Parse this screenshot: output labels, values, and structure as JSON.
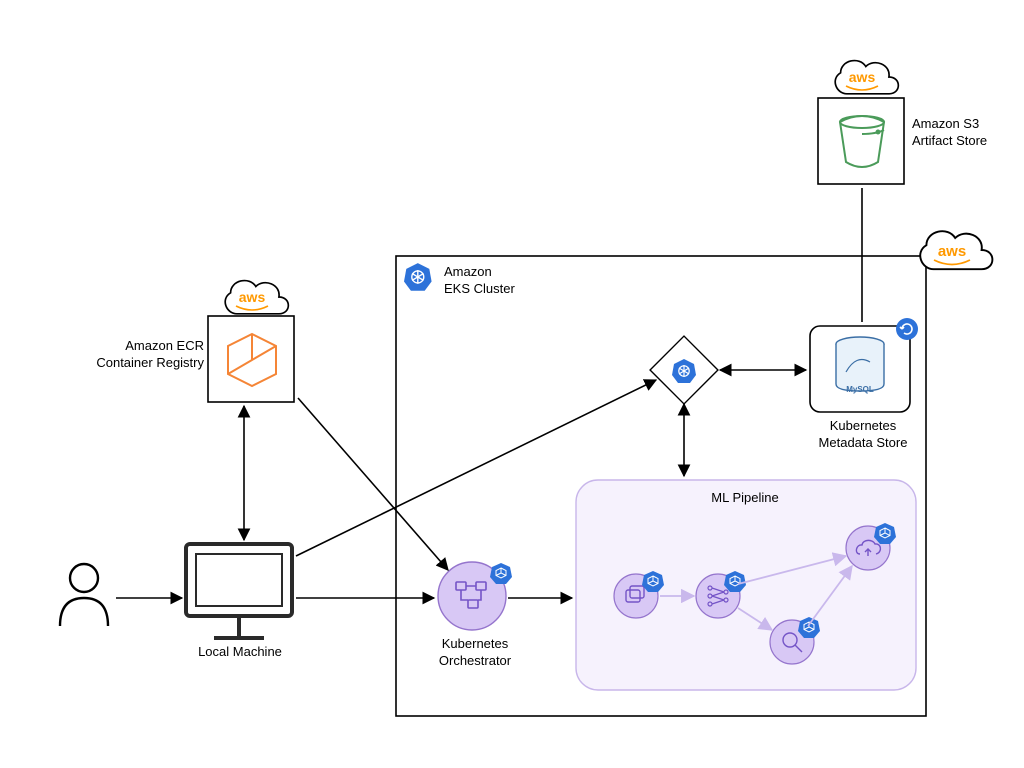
{
  "nodes": {
    "user": {
      "label": ""
    },
    "local_machine": {
      "label": "Local Machine"
    },
    "ecr": {
      "label": "Amazon ECR\nContainer Registry"
    },
    "eks_cluster": {
      "label": "Amazon\nEKS Cluster"
    },
    "orchestrator": {
      "label": "Kubernetes\nOrchestrator"
    },
    "k8s_diamond": {
      "label": ""
    },
    "metadata_store": {
      "label": "Kubernetes\nMetadata Store"
    },
    "ml_pipeline": {
      "label": "ML Pipeline"
    },
    "step_data": {
      "label": ""
    },
    "step_train": {
      "label": ""
    },
    "step_eval": {
      "label": ""
    },
    "step_deploy": {
      "label": ""
    },
    "s3": {
      "label": "Amazon S3\nArtifact Store"
    },
    "aws_top": {
      "label": "aws"
    },
    "aws_mid": {
      "label": "aws"
    },
    "aws_left": {
      "label": "aws"
    }
  },
  "edges": [
    {
      "from": "user",
      "to": "local_machine",
      "dir": "fwd"
    },
    {
      "from": "local_machine",
      "to": "ecr",
      "dir": "both"
    },
    {
      "from": "local_machine",
      "to": "orchestrator",
      "dir": "fwd"
    },
    {
      "from": "local_machine",
      "to": "k8s_diamond",
      "dir": "fwd"
    },
    {
      "from": "ecr",
      "to": "orchestrator",
      "dir": "fwd"
    },
    {
      "from": "orchestrator",
      "to": "ml_pipeline",
      "dir": "fwd"
    },
    {
      "from": "k8s_diamond",
      "to": "metadata_store",
      "dir": "both"
    },
    {
      "from": "k8s_diamond",
      "to": "ml_pipeline",
      "dir": "both"
    },
    {
      "from": "metadata_store",
      "to": "s3",
      "dir": "up"
    },
    {
      "from": "step_data",
      "to": "step_train",
      "dir": "fwd",
      "style": "faint"
    },
    {
      "from": "step_train",
      "to": "step_eval",
      "dir": "fwd",
      "style": "faint"
    },
    {
      "from": "step_train",
      "to": "step_deploy",
      "dir": "fwd",
      "style": "faint"
    },
    {
      "from": "step_eval",
      "to": "step_deploy",
      "dir": "fwd",
      "style": "faint"
    }
  ],
  "icons": {
    "kubernetes": "kubernetes-icon",
    "mysql": "mysql-icon",
    "bucket": "s3-bucket-icon",
    "container": "container-icon",
    "workflow": "workflow-icon",
    "user": "user-icon",
    "computer": "computer-icon",
    "aws_cloud": "aws-cloud-icon"
  },
  "colors": {
    "purple_fill": "#d8c8f5",
    "purple_stroke": "#9575cd",
    "purple_faint": "#e8ddf8",
    "blue_k8s": "#2d72d9",
    "aws_orange": "#ff9900",
    "ecr_orange": "#f58536",
    "s3_green": "#4b9b5a"
  }
}
